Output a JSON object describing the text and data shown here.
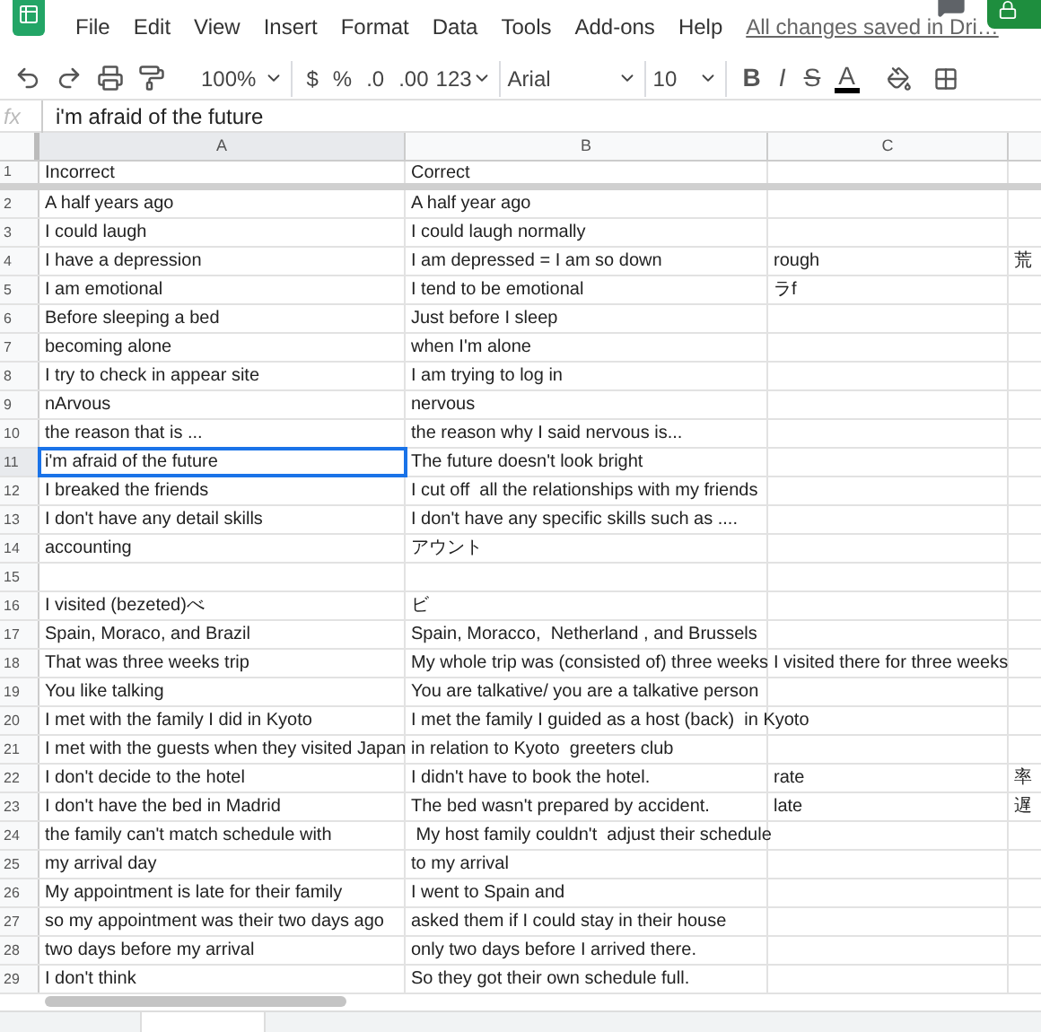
{
  "menu": [
    "File",
    "Edit",
    "View",
    "Insert",
    "Format",
    "Data",
    "Tools",
    "Add-ons",
    "Help"
  ],
  "save_status": "All changes saved in Dri…",
  "toolbar": {
    "zoom": "100%",
    "currency": "$",
    "percent": "%",
    "decrease_decimals": ".0",
    "increase_decimals": ".00",
    "number_format": "123",
    "font": "Arial",
    "font_size": "10",
    "bold": "B",
    "italic": "I",
    "strikethrough": "S",
    "text_color": "A"
  },
  "formula_bar": {
    "label": "fx",
    "value": "i'm afraid of the future"
  },
  "columns": [
    {
      "label": "A",
      "selected": true
    },
    {
      "label": "B",
      "selected": false
    },
    {
      "label": "C",
      "selected": false
    }
  ],
  "rows": [
    {
      "number": "1",
      "selected": false,
      "a": "Incorrect",
      "b": "Correct"
    },
    {
      "number": "2",
      "selected": false,
      "a": "A half years ago",
      "b": "A half year ago"
    },
    {
      "number": "3",
      "selected": false,
      "a": "I could laugh",
      "b": "I could laugh normally"
    },
    {
      "number": "4",
      "selected": false,
      "a": "I have a depression",
      "b": "I am depressed = I am so down",
      "c": "rough",
      "d": "荒"
    },
    {
      "number": "5",
      "selected": false,
      "a": "I am emotional",
      "b": "I tend to be emotional",
      "c": "ラf"
    },
    {
      "number": "6",
      "selected": false,
      "a": "Before sleeping a bed",
      "b": "Just before I sleep"
    },
    {
      "number": "7",
      "selected": false,
      "a": "becoming alone",
      "b": "when I'm alone"
    },
    {
      "number": "8",
      "selected": false,
      "a": "I try to check in appear site",
      "b": "I am trying to log in"
    },
    {
      "number": "9",
      "selected": false,
      "a": "nArvous",
      "b": "nervous"
    },
    {
      "number": "10",
      "selected": false,
      "a": "the reason that is ...",
      "b": "the reason why I said nervous is..."
    },
    {
      "number": "11",
      "selected": true,
      "a": "i'm afraid of the future",
      "b": "The future doesn't look bright"
    },
    {
      "number": "12",
      "selected": false,
      "a": "I breaked the friends",
      "b": "I cut off  all the relationships with my friends"
    },
    {
      "number": "13",
      "selected": false,
      "a": "I don't have any detail skills",
      "b": "I don't have any specific skills such as ...."
    },
    {
      "number": "14",
      "selected": false,
      "a": "accounting",
      "b": "アウント"
    },
    {
      "number": "15",
      "selected": false
    },
    {
      "number": "16",
      "selected": false,
      "a": "I visited (bezeted)べ",
      "b": "ビ"
    },
    {
      "number": "17",
      "selected": false,
      "a": "Spain, Moraco, and Brazil",
      "b": "Spain, Moracco,  Netherland , and Brussels"
    },
    {
      "number": "18",
      "selected": false,
      "a": "That was three weeks trip",
      "b": "My whole trip was (consisted of) three weeks",
      "c": "I visited there for three weeks"
    },
    {
      "number": "19",
      "selected": false,
      "a": "You like talking",
      "b": "You are talkative/ you are a talkative person"
    },
    {
      "number": "20",
      "selected": false,
      "a": "I met with the family I did in Kyoto",
      "b": "I met the family I guided as a host (back)  in Kyoto"
    },
    {
      "number": "21",
      "selected": false,
      "a": "I met with the guests when they visited Japan",
      "b": "in relation to Kyoto  greeters club"
    },
    {
      "number": "22",
      "selected": false,
      "a": "I don't decide to the hotel",
      "b": "I didn't have to book the hotel.",
      "c": "rate",
      "d": "率"
    },
    {
      "number": "23",
      "selected": false,
      "a": "I don't have the bed in Madrid",
      "b": "The bed wasn't prepared by accident.",
      "c": "late",
      "d": "遅"
    },
    {
      "number": "24",
      "selected": false,
      "a": "the family can't match schedule with",
      "b": " My host family couldn't  adjust their schedule"
    },
    {
      "number": "25",
      "selected": false,
      "a": "my arrival day",
      "b": "to my arrival"
    },
    {
      "number": "26",
      "selected": false,
      "a": "My appointment is late for their family",
      "b": "I went to Spain and"
    },
    {
      "number": "27",
      "selected": false,
      "a": "so my appointment was their two days ago",
      "b": "asked them if I could stay in their house"
    },
    {
      "number": "28",
      "selected": false,
      "a": "two days before my arrival",
      "b": "only two days before I arrived there."
    },
    {
      "number": "29",
      "selected": false,
      "a": "I don't think",
      "b": "So they got their own schedule full."
    }
  ]
}
